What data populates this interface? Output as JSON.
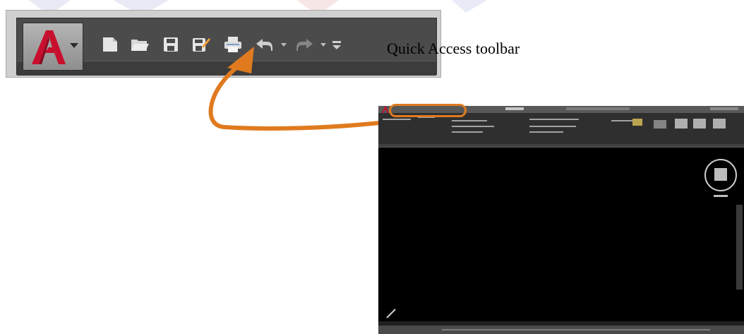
{
  "callout": {
    "label": "Quick Access toolbar"
  },
  "quick_access_toolbar": {
    "buttons": [
      "application-menu",
      "new",
      "open",
      "save",
      "save-as",
      "plot",
      "undo",
      "redo",
      "customize"
    ]
  },
  "colors": {
    "accent_orange": "#e07a1f",
    "autocad_red": "#c8102e",
    "toolbar_gray": "#4b4b4b",
    "drawing_area": "#000000"
  }
}
